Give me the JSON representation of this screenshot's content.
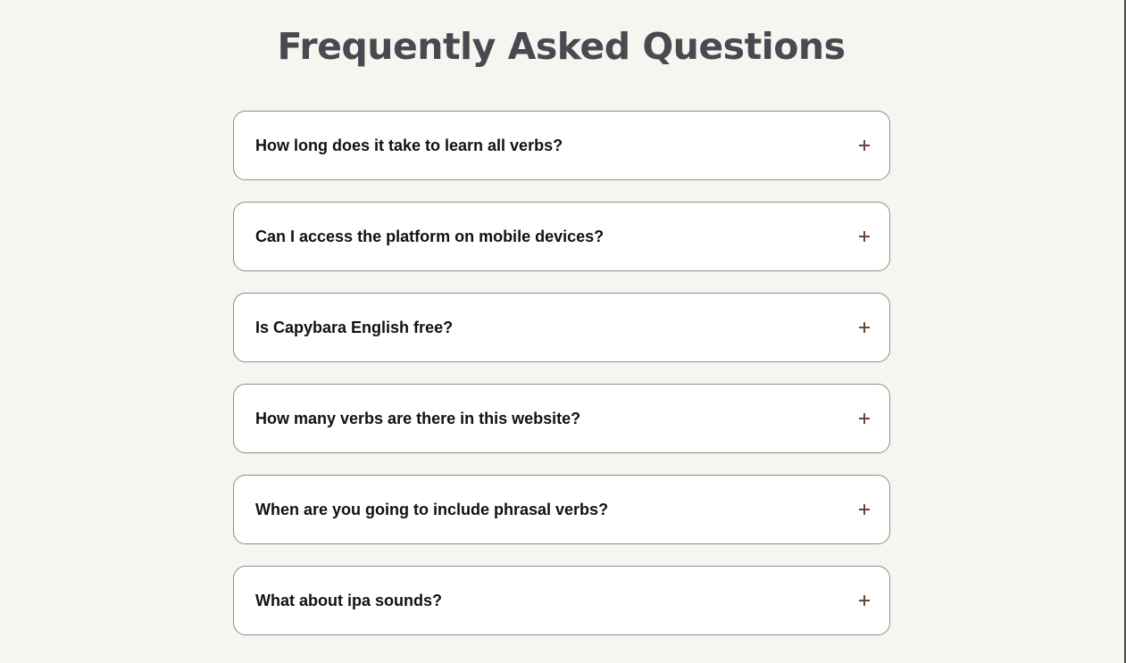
{
  "page": {
    "title": "Frequently Asked Questions"
  },
  "faq": {
    "items": [
      {
        "question": "How long does it take to learn all verbs?",
        "icon": "plus-icon"
      },
      {
        "question": "Can I access the platform on mobile devices?",
        "icon": "plus-icon"
      },
      {
        "question": "Is Capybara English free?",
        "icon": "plus-icon"
      },
      {
        "question": "How many verbs are there in this website?",
        "icon": "plus-icon"
      },
      {
        "question": "When are you going to include phrasal verbs?",
        "icon": "plus-icon"
      },
      {
        "question": "What about ipa sounds?",
        "icon": "plus-icon"
      }
    ]
  },
  "colors": {
    "background": "#f6f5f0",
    "title": "#4a4850",
    "card_border": "#8e8e8e",
    "icon": "#6b4630",
    "question_text": "#111111"
  }
}
